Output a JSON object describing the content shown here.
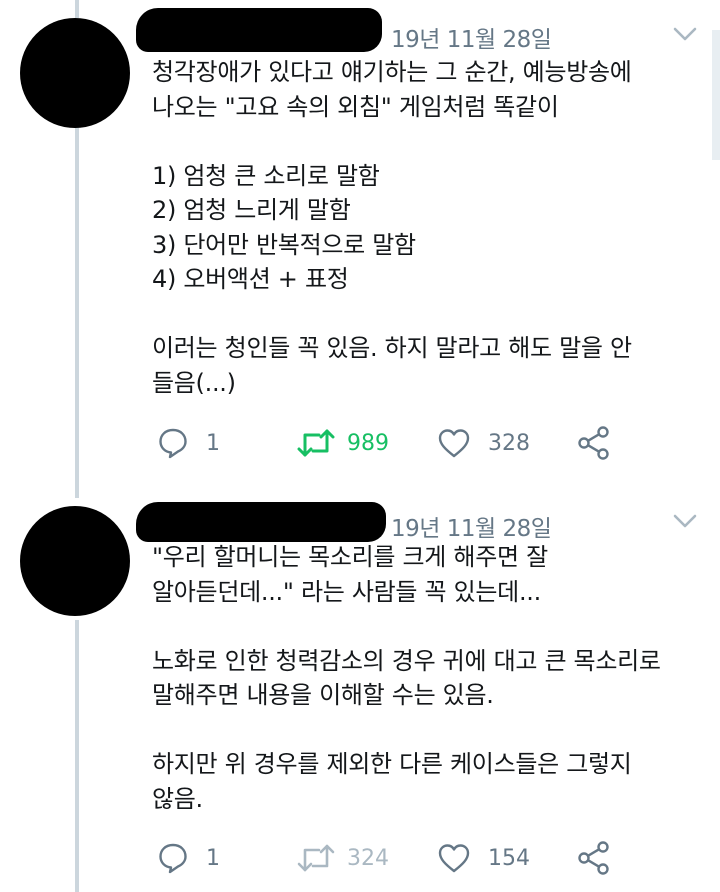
{
  "tweets": [
    {
      "timestamp": "19년 11월 28일",
      "text": "청각장애가 있다고 얘기하는 그 순간, 예능방송에\n나오는 \"고요 속의 외침\" 게임처럼 똑같이\n\n1) 엄청 큰 소리로 말함\n2) 엄청 느리게 말함\n3) 단어만 반복적으로 말함\n4) 오버액션 + 표정\n\n이러는 청인들 꼭 있음. 하지 말라고 해도 말을 안\n들음(...)",
      "replies": "1",
      "retweets": "989",
      "likes": "328",
      "retweeted": true
    },
    {
      "timestamp": "19년 11월 28일",
      "text": "\"우리 할머니는 목소리를 크게 해주면 잘\n알아듣던데...\" 라는 사람들 꼭 있는데...\n\n노화로 인한 청력감소의 경우 귀에 대고 큰 목소리로\n말해주면 내용을 이해할 수는 있음.\n\n하지만 위 경우를 제외한 다른 케이스들은 그렇지\n않음.",
      "replies": "1",
      "retweets": "324",
      "likes": "154",
      "retweeted": false
    }
  ],
  "colors": {
    "text": "#14171a",
    "secondary": "#657786",
    "retweet_active": "#17bf63",
    "thread_line": "#ccd6dd"
  },
  "icons": [
    "reply-icon",
    "retweet-icon",
    "like-icon",
    "share-icon",
    "chevron-down-icon"
  ]
}
